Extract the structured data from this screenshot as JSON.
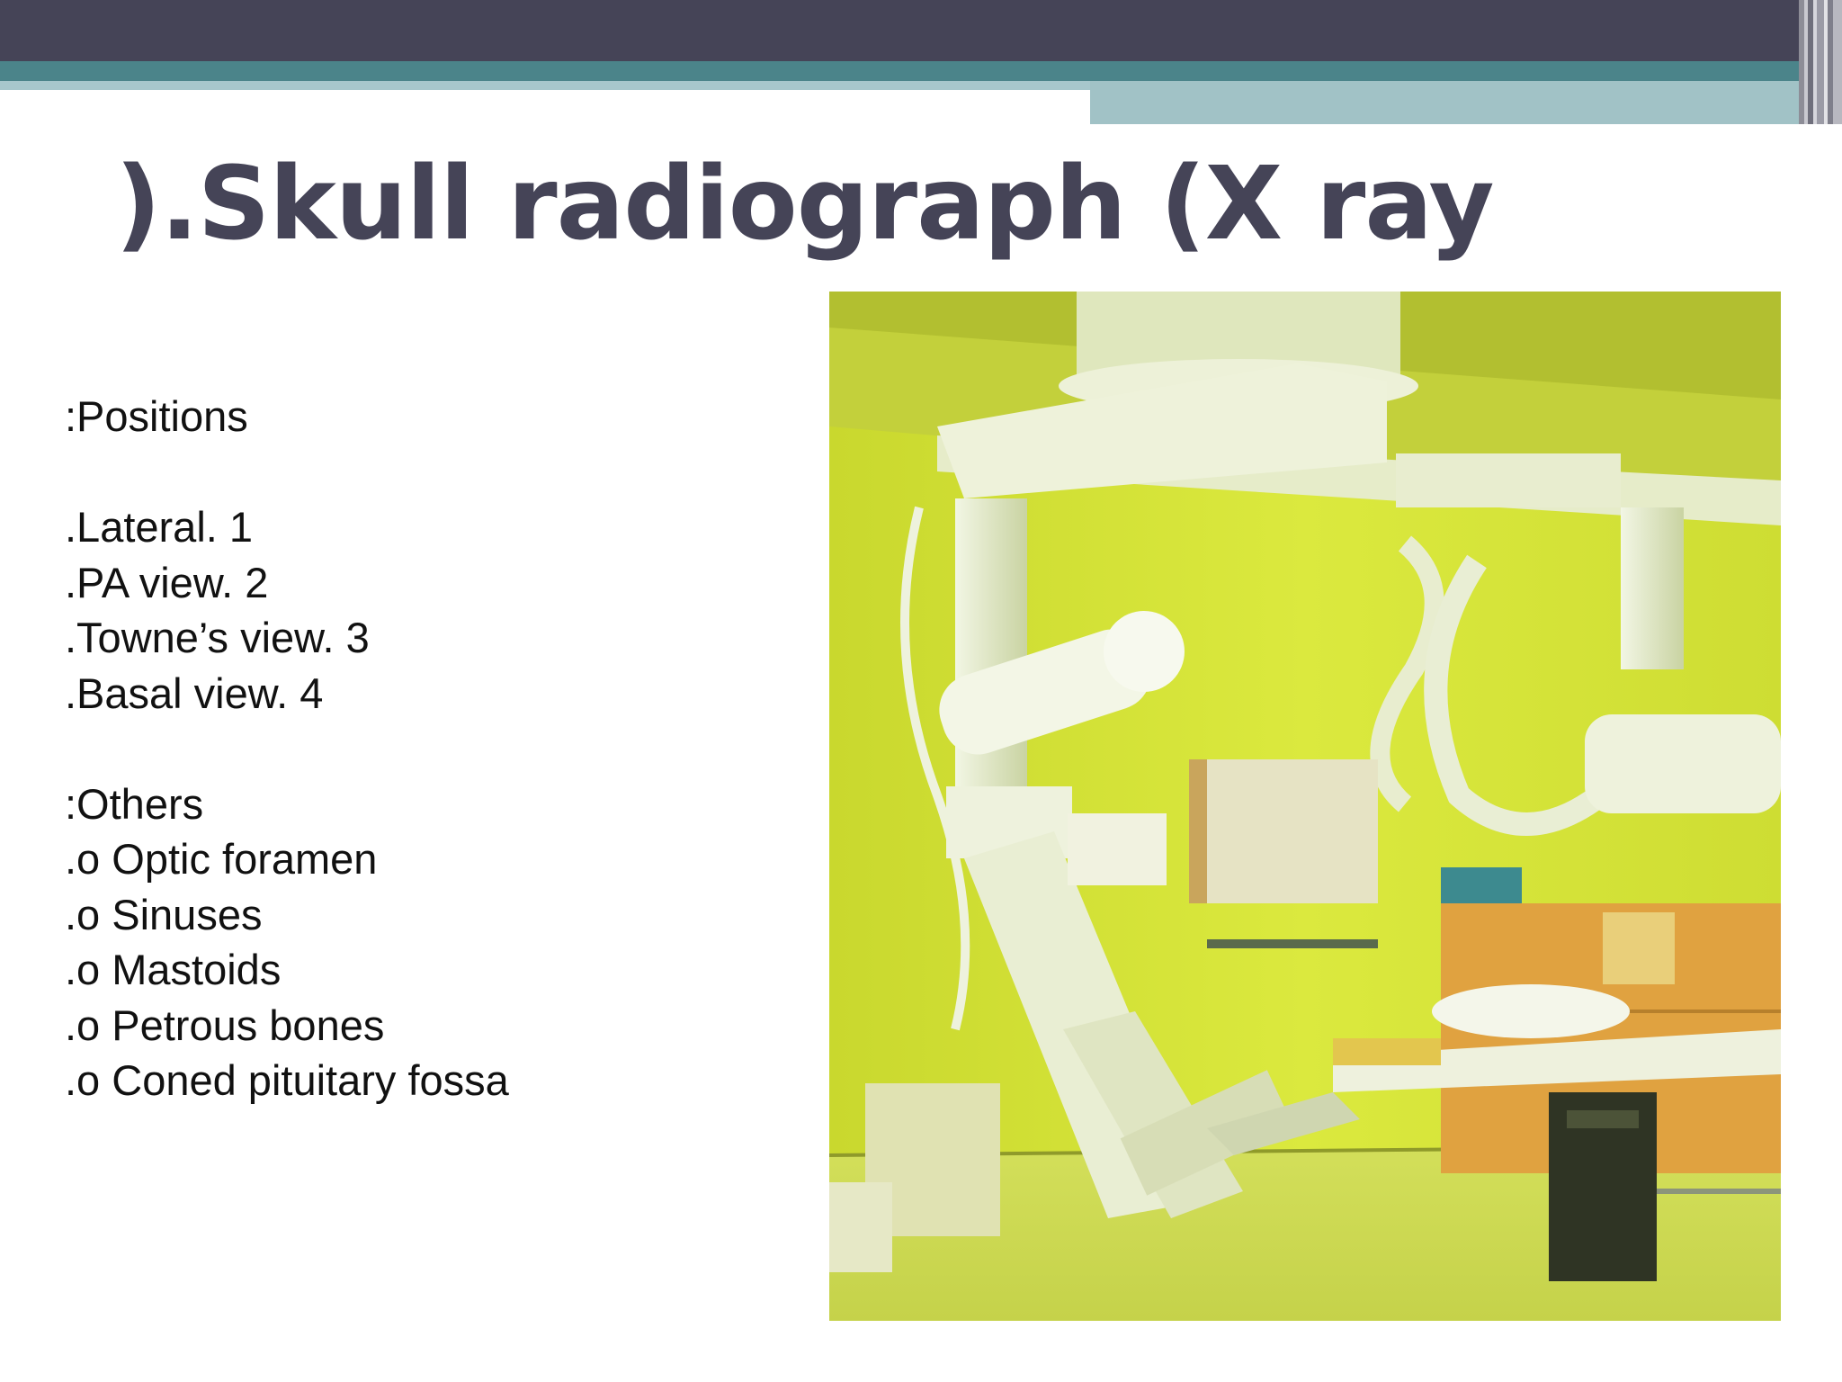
{
  "slide": {
    "title": ").Skull radiograph (X ray",
    "positions_heading": ":Positions",
    "positions": [
      ".Lateral. 1",
      ".PA view. 2",
      ".Towne’s view. 3",
      ".Basal view. 4"
    ],
    "others_heading": ":Others",
    "others": [
      ".o Optic foramen",
      ".o Sinuses",
      ".o Mastoids",
      ".o Petrous bones",
      ".o Coned pituitary fossa"
    ]
  },
  "colors": {
    "header_bar": "#454457",
    "teal_band": "#4b848a",
    "light_band": "#a1c2c6",
    "title_text": "#454457",
    "room_wall": "#d4e33a"
  },
  "photo": {
    "subject": "x-ray-room-equipment"
  }
}
